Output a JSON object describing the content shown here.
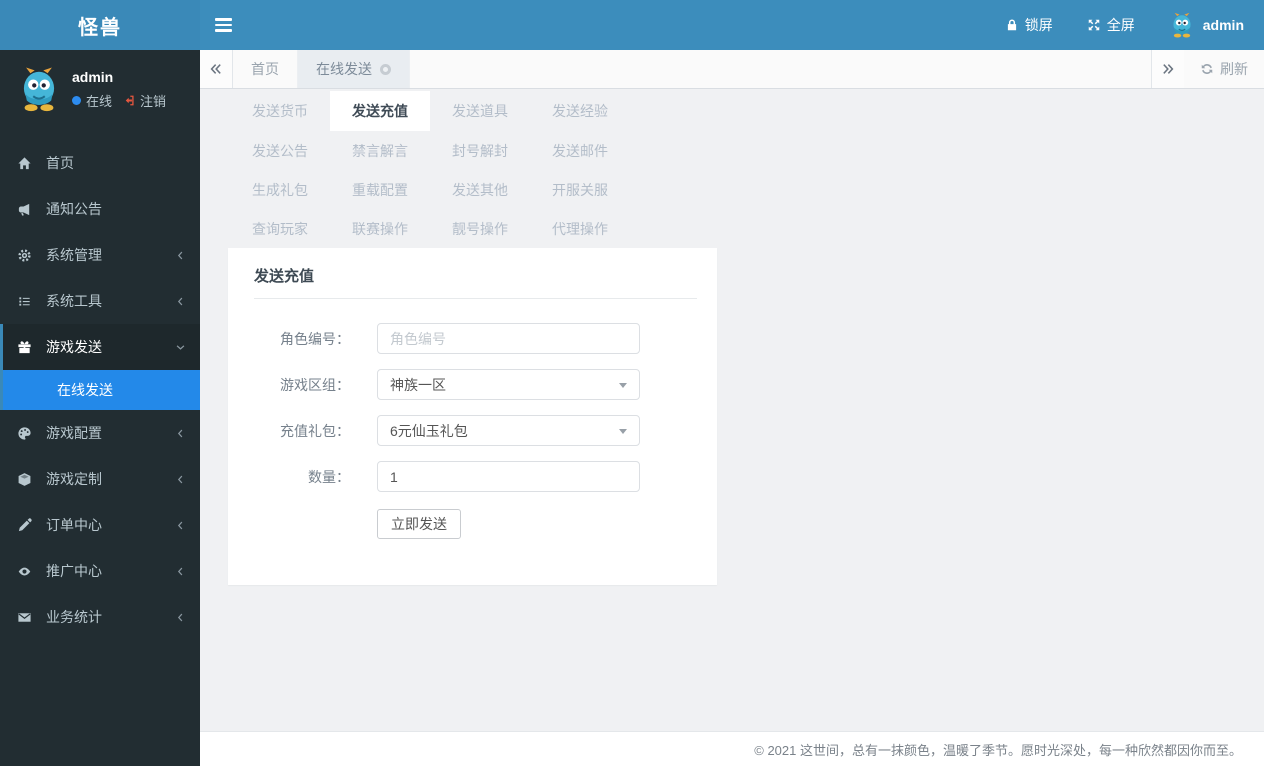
{
  "brand": {
    "title": "怪兽"
  },
  "navbar": {
    "lock_label": "锁屏",
    "fullscreen_label": "全屏",
    "username": "admin"
  },
  "tabbar": {
    "home_tab": "首页",
    "active_tab": "在线发送",
    "refresh_label": "刷新"
  },
  "sidebar": {
    "user": {
      "name": "admin",
      "status_label": "在线",
      "logout_label": "注销"
    },
    "items": [
      {
        "label": "首页"
      },
      {
        "label": "通知公告"
      },
      {
        "label": "系统管理"
      },
      {
        "label": "系统工具"
      },
      {
        "label": "游戏发送"
      },
      {
        "label": "游戏配置"
      },
      {
        "label": "游戏定制"
      },
      {
        "label": "订单中心"
      },
      {
        "label": "推广中心"
      },
      {
        "label": "业务统计"
      }
    ],
    "submenu_active": {
      "label": "在线发送"
    }
  },
  "quick_nav": {
    "items": [
      {
        "label": "发送货币"
      },
      {
        "label": "发送充值",
        "active": true
      },
      {
        "label": "发送道具"
      },
      {
        "label": "发送经验"
      },
      {
        "label": "发送公告"
      },
      {
        "label": "禁言解言"
      },
      {
        "label": "封号解封"
      },
      {
        "label": "发送邮件"
      },
      {
        "label": "生成礼包"
      },
      {
        "label": "重载配置"
      },
      {
        "label": "发送其他"
      },
      {
        "label": "开服关服"
      },
      {
        "label": "查询玩家"
      },
      {
        "label": "联赛操作"
      },
      {
        "label": "靓号操作"
      },
      {
        "label": "代理操作"
      }
    ]
  },
  "form": {
    "title": "发送充值",
    "role_id": {
      "label": "角色编号：",
      "placeholder": "角色编号"
    },
    "server": {
      "label": "游戏区组：",
      "value": "神族一区"
    },
    "package": {
      "label": "充值礼包：",
      "value": "6元仙玉礼包"
    },
    "quantity": {
      "label": "数量：",
      "value": "1"
    },
    "submit_label": "立即发送"
  },
  "footer": {
    "copyright": "© 2021 这世间，总有一抹颜色，温暖了季节。愿时光深处，每一种欣然都因你而至。"
  },
  "colors": {
    "navbar_bg": "#3c8dbc",
    "sidebar_bg": "#222d32",
    "sidebar_active_bg": "#2389e9",
    "content_bg": "#f0f1f3",
    "status_online": "#2d8cf0"
  }
}
